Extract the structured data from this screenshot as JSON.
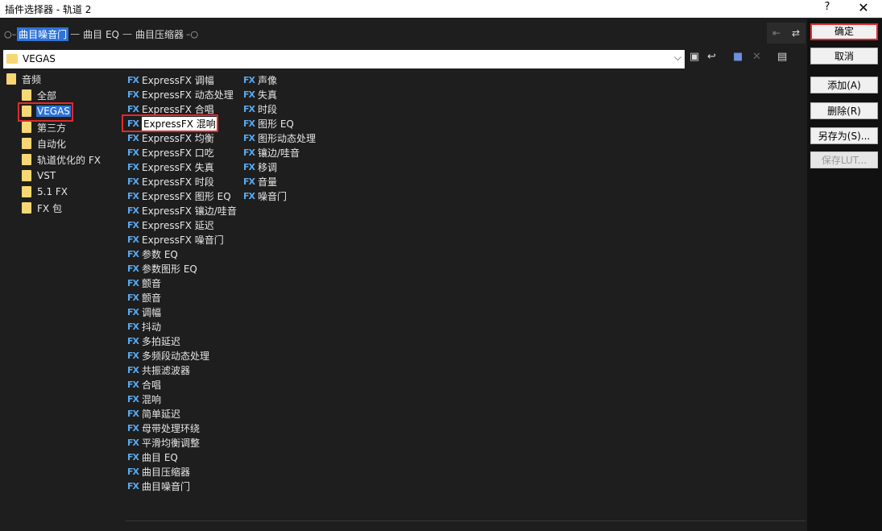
{
  "window": {
    "title": "插件选择器 - 轨道 2",
    "help": "?",
    "close": "✕"
  },
  "chain": {
    "items": [
      {
        "label": "曲目噪音门",
        "selected": true
      },
      {
        "label": "曲目 EQ",
        "selected": false
      },
      {
        "label": "曲目压缩器",
        "selected": false
      }
    ]
  },
  "top_icons": [
    "remove-icon",
    "swap-icon"
  ],
  "path": {
    "value": "VEGAS"
  },
  "toolbar_icons": [
    "folder-up-icon",
    "back-icon",
    "new-folder-icon",
    "delete-icon",
    "view-icon"
  ],
  "tree": {
    "root": "音频",
    "children": [
      "全部",
      "VEGAS",
      "第三方",
      "自动化",
      "轨道优化的 FX",
      "VST",
      "5.1 FX",
      "FX 包"
    ],
    "selected": "VEGAS"
  },
  "fx_col1": [
    "ExpressFX 调幅",
    "ExpressFX 动态处理",
    "ExpressFX 合唱",
    "ExpressFX 混响",
    "ExpressFX 均衡",
    "ExpressFX 口吃",
    "ExpressFX 失真",
    "ExpressFX 时段",
    "ExpressFX 图形 EQ",
    "ExpressFX 镶边/哇音",
    "ExpressFX 延迟",
    "ExpressFX 噪音门",
    "参数 EQ",
    "参数图形 EQ",
    "颤音",
    "颤音",
    "调幅",
    "抖动",
    "多拍延迟",
    "多频段动态处理",
    "共振滤波器",
    "合唱",
    "混响",
    "简单延迟",
    "母带处理环绕",
    "平滑均衡调整",
    "曲目 EQ",
    "曲目压缩器",
    "曲目噪音门"
  ],
  "fx_col2": [
    "声像",
    "失真",
    "时段",
    "图形 EQ",
    "图形动态处理",
    "镶边/哇音",
    "移调",
    "音量",
    "噪音门"
  ],
  "fx_highlighted": "ExpressFX 混响",
  "fx_icon_text": "FX",
  "buttons": {
    "ok": "确定",
    "cancel": "取消",
    "add": "添加(A)",
    "remove": "删除(R)",
    "save_as": "另存为(S)...",
    "save_lut": "保存LUT..."
  }
}
